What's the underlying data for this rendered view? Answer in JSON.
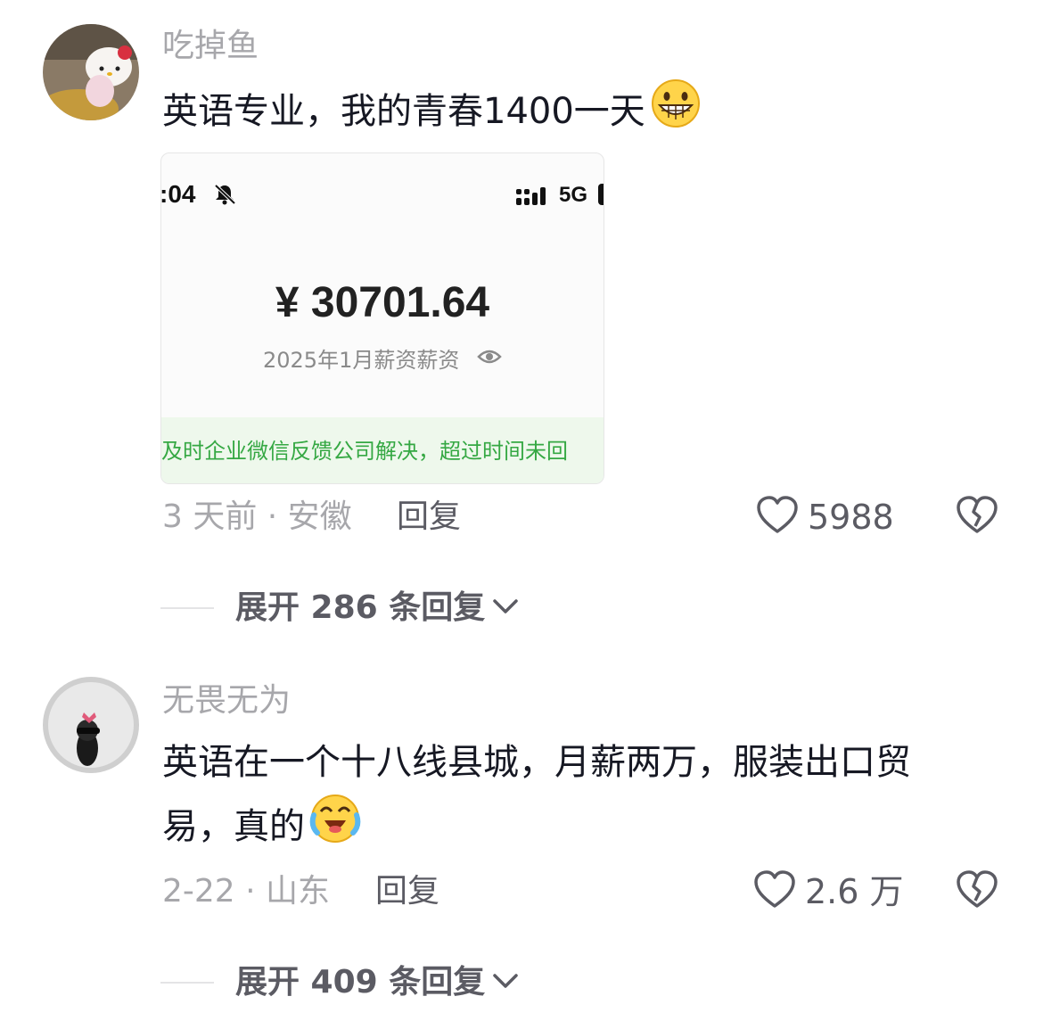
{
  "comments": [
    {
      "username": "吃掉鱼",
      "text": "英语专业，我的青春1400一天",
      "emoji": "grinning-face-emoji",
      "screenshot": {
        "time": ":04",
        "network": "5G",
        "amount": "¥ 30701.64",
        "label": "2025年1月薪资薪资",
        "banner": "及时企业微信反馈公司解决，超过时间未回"
      },
      "date": "3 天前 · 安徽",
      "reply_label": "回复",
      "likes": "5988",
      "expand_label": "展开 286 条回复"
    },
    {
      "username": "无畏无为",
      "text_line1": "英语在一个十八线县城，月薪两万，服装出口贸",
      "text_line2": "易，真的",
      "emoji": "crying-laughing-face-emoji",
      "date": "2-22 · 山东",
      "reply_label": "回复",
      "likes": "2.6 万",
      "expand_label": "展开 409 条回复"
    }
  ],
  "colors": {
    "secondary_text": "#a7a7ab",
    "primary_text": "#161823",
    "action_text": "#5b5b63",
    "banner_green": "#35a843"
  }
}
